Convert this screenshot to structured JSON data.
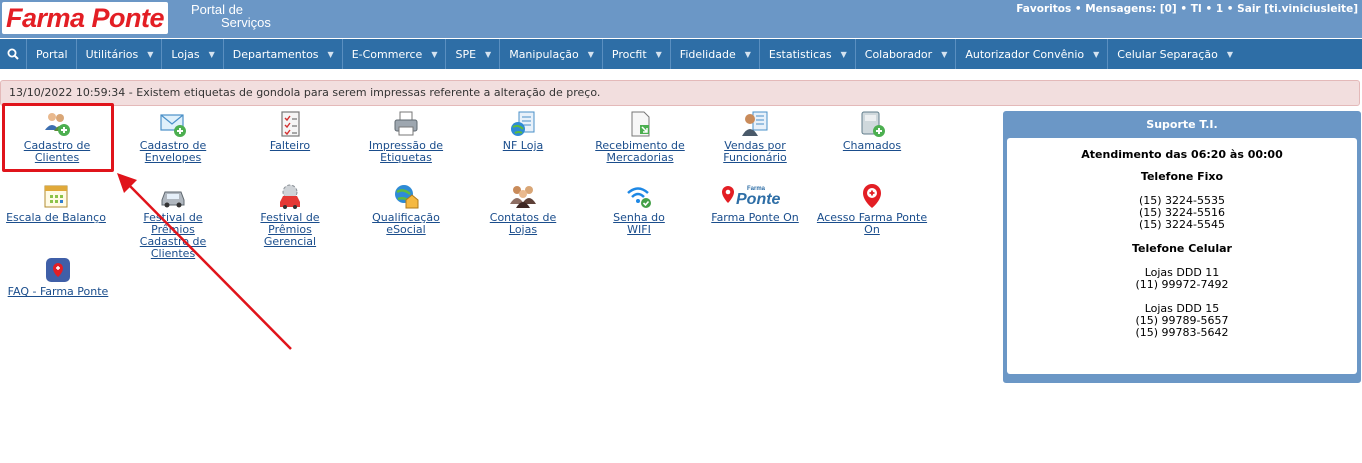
{
  "header": {
    "logo_text": "Farma Ponte",
    "portal_line1": "Portal de",
    "portal_line2": "Serviços",
    "user_bar": "Favoritos • Mensagens: [0] • TI • 1 • Sair [ti.viniciusleite]"
  },
  "nav": {
    "search_icon": "search-icon",
    "items": [
      {
        "label": "Portal",
        "has_caret": false
      },
      {
        "label": "Utilitários",
        "has_caret": true
      },
      {
        "label": "Lojas",
        "has_caret": true
      },
      {
        "label": "Departamentos",
        "has_caret": true
      },
      {
        "label": "E-Commerce",
        "has_caret": true
      },
      {
        "label": "SPE",
        "has_caret": true
      },
      {
        "label": "Manipulação",
        "has_caret": true
      },
      {
        "label": "Procfit",
        "has_caret": true
      },
      {
        "label": "Fidelidade",
        "has_caret": true
      },
      {
        "label": "Estatisticas",
        "has_caret": true
      },
      {
        "label": "Colaborador",
        "has_caret": true
      },
      {
        "label": "Autorizador Convênio",
        "has_caret": true
      },
      {
        "label": "Celular Separação",
        "has_caret": true
      }
    ]
  },
  "alert": {
    "text": "13/10/2022 10:59:34 - Existem etiquetas de gondola para serem impressas referente a alteração de preço."
  },
  "shortcuts": {
    "cadastro_clientes": {
      "line1": "Cadastro de",
      "line2": "Clientes",
      "icon": "users-add-icon"
    },
    "cadastro_envelopes": {
      "line1": "Cadastro de",
      "line2": "Envelopes",
      "icon": "envelope-add-icon"
    },
    "falteiro": {
      "line1": "Falteiro",
      "icon": "checklist-icon"
    },
    "impressao_etiquetas": {
      "line1": "Impressão de",
      "line2": "Etiquetas",
      "icon": "printer-icon"
    },
    "nf_loja": {
      "line1": "NF Loja",
      "icon": "globe-document-icon"
    },
    "recebimento": {
      "line1": "Recebimento de",
      "line2": "Mercadorias",
      "icon": "document-import-icon"
    },
    "vendas_funcionario": {
      "line1": "Vendas por",
      "line2": "Funcionário",
      "icon": "employee-sales-icon"
    },
    "chamados": {
      "line1": "Chamados",
      "icon": "phone-add-icon"
    },
    "escala_balanco": {
      "line1": "Escala de Balanço",
      "icon": "calendar-icon"
    },
    "festival_cadastro": {
      "line1": "Festival de",
      "line2": "Prêmios",
      "line3": "Cadastro de",
      "line4": "Clientes",
      "icon": "car-icon"
    },
    "festival_gerencial": {
      "line1": "Festival de",
      "line2": "Prêmios",
      "line3": "Gerencial",
      "icon": "car-gear-icon"
    },
    "qualificacao_esocial": {
      "line1": "Qualificação",
      "line2": "eSocial",
      "icon": "globe-house-icon"
    },
    "contatos_lojas": {
      "line1": "Contatos de",
      "line2": "Lojas",
      "icon": "contacts-icon"
    },
    "senha_wifi": {
      "line1": "Senha do",
      "line2": "WIFI",
      "icon": "wifi-check-icon"
    },
    "farma_ponte_on": {
      "line1": "Farma Ponte On",
      "icon": "farma-ponte-logo",
      "logo_small": "Farma",
      "logo_big": "Ponte"
    },
    "acesso_farma_ponte_on": {
      "line1": "Acesso Farma Ponte",
      "line2": "On",
      "icon": "location-pin-icon"
    },
    "faq": {
      "line1": "FAQ - Farma Ponte",
      "icon": "faq-app-icon"
    }
  },
  "suporte": {
    "title": "Suporte T.I.",
    "atendimento": "Atendimento das 06:20 às 00:00",
    "fixo_title": "Telefone Fixo",
    "fixo": [
      "(15) 3224-5535",
      "(15) 3224-5516",
      "(15) 3224-5545"
    ],
    "celular_title": "Telefone Celular",
    "ddd11_label": "Lojas DDD 11",
    "ddd11": [
      "(11) 99972-7492"
    ],
    "ddd15_label": "Lojas DDD 15",
    "ddd15": [
      "(15) 99789-5657",
      "(15) 99783-5642"
    ]
  },
  "colors": {
    "header_bg": "#6b97c6",
    "nav_bg": "#2e6ea6",
    "brand_red": "#e31e24",
    "alert_bg": "#f2dede",
    "link": "#1a4d8c"
  }
}
